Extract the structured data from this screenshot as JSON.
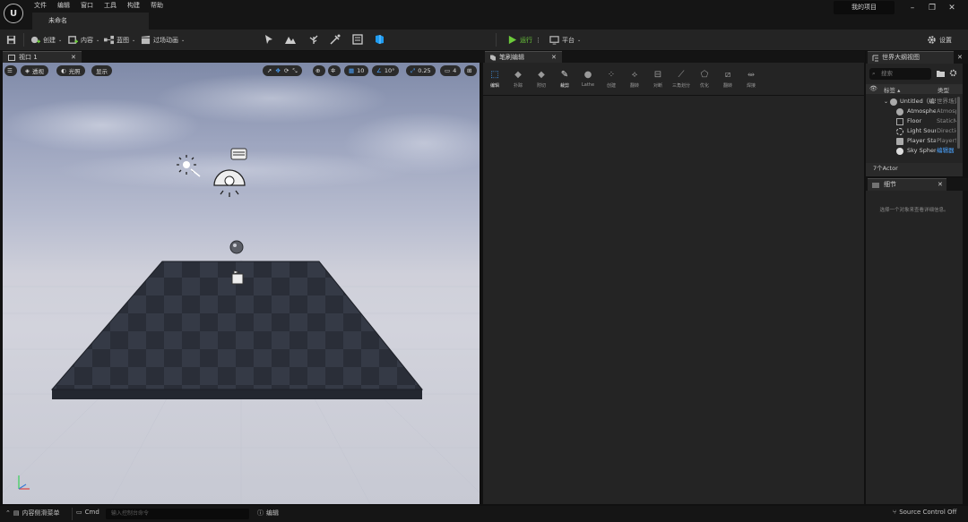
{
  "app": {
    "menu": [
      "文件",
      "编辑",
      "窗口",
      "工具",
      "构建",
      "帮助"
    ],
    "document_tab": "未命名",
    "project_name": "我的项目"
  },
  "toolbar": {
    "save_icon": "save-icon",
    "create_label": "创建",
    "content_label": "内容",
    "blueprint_label": "蓝图",
    "cinematics_label": "过场动画",
    "play_label": "运行",
    "platform_label": "平台",
    "settings_label": "设置"
  },
  "viewport": {
    "tab_label": "视口 1",
    "perspective_label": "透视",
    "lit_label": "光照",
    "show_label": "显示",
    "grid_snap": "10",
    "rotation_snap": "10°",
    "scale_snap": "0.25",
    "camera_speed": "4"
  },
  "brush_editor": {
    "tab_label": "笔刷编辑",
    "tools": [
      "编辑",
      "扑踪",
      "附切",
      "裁剪",
      "Lathe",
      "创建",
      "翻转",
      "对断",
      "三角划分",
      "优化",
      "翻转",
      "焊接"
    ],
    "active_tool_index": 0
  },
  "outliner": {
    "tab_label": "世界大纲视图",
    "search_placeholder": "搜索",
    "col_label": "标签",
    "col_type": "类型",
    "rows": [
      {
        "name": "Untitled（编辑器）",
        "type": "世界场景"
      },
      {
        "name": "Atmosphere",
        "type": "Atmosphere"
      },
      {
        "name": "Floor",
        "type": "StaticMesh"
      },
      {
        "name": "Light Source",
        "type": "DirectionalLight"
      },
      {
        "name": "Player Start",
        "type": "PlayerStart"
      },
      {
        "name": "Sky Sphere",
        "type": "编辑器"
      }
    ],
    "actor_count": "7个Actor"
  },
  "details": {
    "tab_label": "细节",
    "empty_message": "选择一个对象来查看详细信息。"
  },
  "statusbar": {
    "content_drawer": "内容侧滑菜单",
    "cmd_label": "Cmd",
    "cmd_placeholder": "输入控制台命令",
    "derived_data": "编辑",
    "source_control": "Source Control Off"
  },
  "colors": {
    "accent_blue": "#4aa3ff",
    "play_green": "#6ccb3b",
    "panel_bg": "#242424"
  }
}
